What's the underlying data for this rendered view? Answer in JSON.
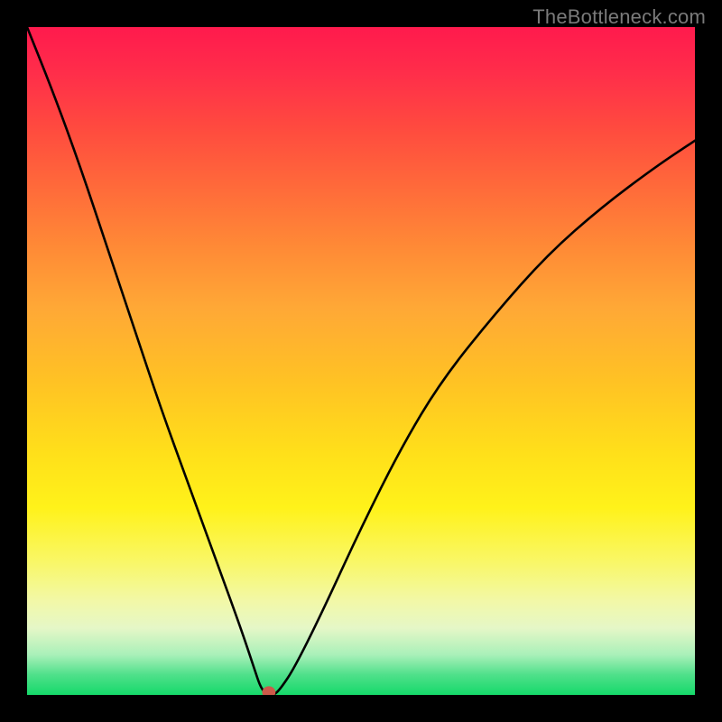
{
  "watermark": "TheBottleneck.com",
  "chart_data": {
    "type": "line",
    "title": "",
    "xlabel": "",
    "ylabel": "",
    "xlim": [
      0,
      100
    ],
    "ylim": [
      0,
      100
    ],
    "grid": false,
    "legend": false,
    "background_gradient": {
      "direction": "vertical",
      "stops": [
        {
          "pos": 0,
          "color": "#ff1a4d"
        },
        {
          "pos": 50,
          "color": "#ffbf2a"
        },
        {
          "pos": 80,
          "color": "#f8f66a"
        },
        {
          "pos": 100,
          "color": "#15d96a"
        }
      ]
    },
    "series": [
      {
        "name": "bottleneck-curve",
        "color": "#000000",
        "x": [
          0,
          4,
          8,
          12,
          16,
          20,
          24,
          28,
          32,
          34,
          35,
          36,
          37,
          38,
          40,
          44,
          50,
          56,
          62,
          70,
          78,
          86,
          94,
          100
        ],
        "y": [
          100,
          90,
          79,
          67,
          55,
          43,
          32,
          21,
          10,
          4,
          1,
          0,
          0,
          1,
          4,
          12,
          25,
          37,
          47,
          57,
          66,
          73,
          79,
          83
        ]
      }
    ],
    "markers": [
      {
        "name": "bottleneck-point",
        "x": 36.2,
        "y": 0.4,
        "rx": 1.0,
        "ry": 0.9,
        "color": "#cc5a4a"
      }
    ]
  }
}
